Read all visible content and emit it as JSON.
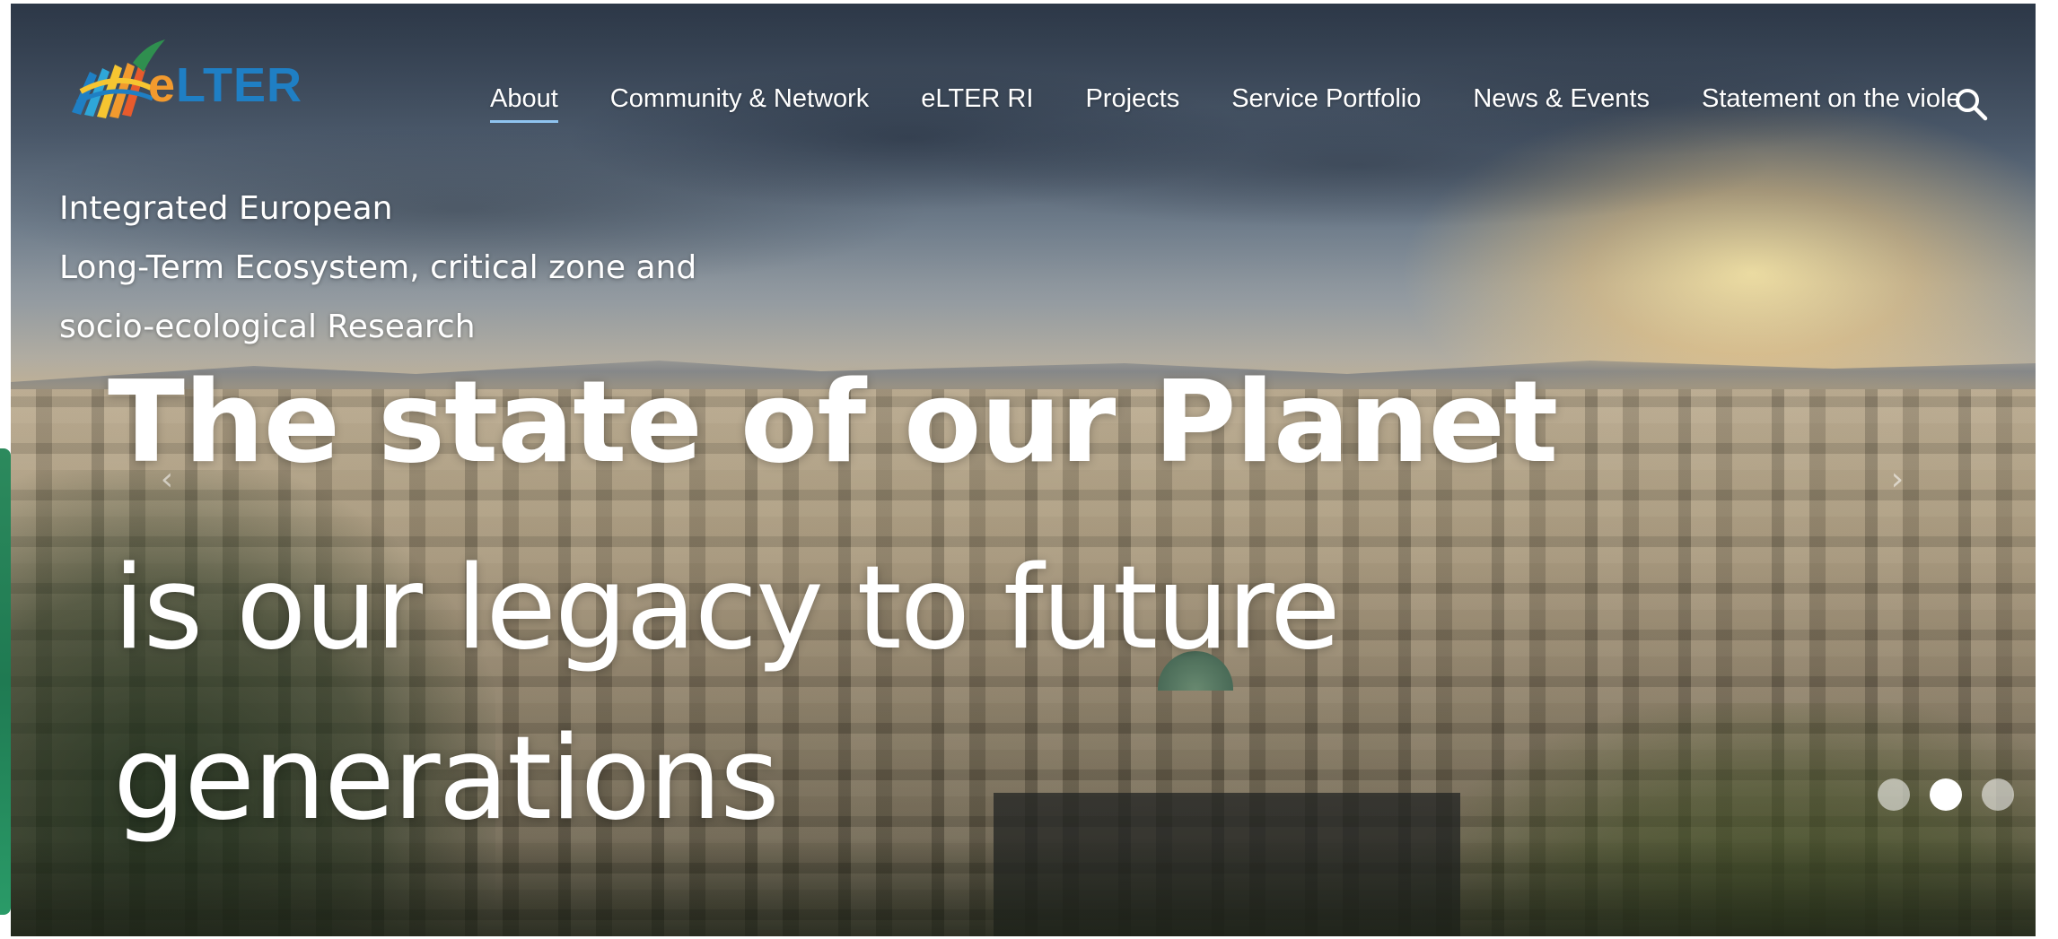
{
  "brand": {
    "logo_e": "e",
    "logo_rest": "LTER",
    "colors": {
      "orange": "#f29a2e",
      "blue": "#1f7fc4"
    }
  },
  "nav": {
    "items": [
      {
        "label": "About",
        "active": true
      },
      {
        "label": "Community & Network",
        "active": false
      },
      {
        "label": "eLTER RI",
        "active": false
      },
      {
        "label": "Projects",
        "active": false
      },
      {
        "label": "Service Portfolio",
        "active": false
      },
      {
        "label": "News & Events",
        "active": false
      },
      {
        "label": "Statement on the viole",
        "active": false
      }
    ],
    "search_icon": "search-icon"
  },
  "hero": {
    "tagline": [
      "Integrated European",
      "Long-Term Ecosystem, critical zone and",
      "socio-ecological Research"
    ],
    "headline_bold": "The state of our Planet",
    "headline_light": "is our legacy to future generations",
    "prev_arrow": "‹",
    "next_arrow": "›",
    "slider": {
      "slide_count": 3,
      "active_slide": 2
    }
  }
}
